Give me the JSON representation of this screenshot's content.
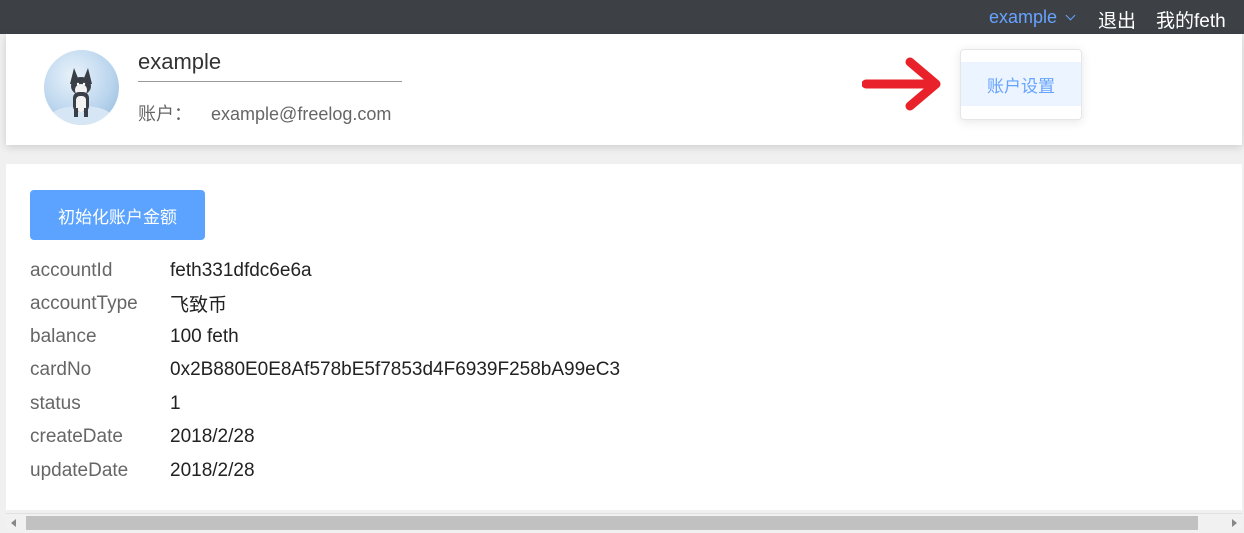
{
  "header": {
    "username": "example",
    "logout_label": "退出",
    "my_feth_label": "我的feth"
  },
  "dropdown": {
    "items": [
      {
        "label": "账户设置"
      }
    ]
  },
  "profile": {
    "name": "example",
    "account_label": "账户：",
    "account_value": "example@freelog.com"
  },
  "main": {
    "init_button_label": "初始化账户金额",
    "fields": [
      {
        "key": "accountId",
        "value": "feth331dfdc6e6a"
      },
      {
        "key": "accountType",
        "value": "飞致币"
      },
      {
        "key": "balance",
        "value": "100 feth"
      },
      {
        "key": "cardNo",
        "value": "0x2B880E0E8Af578bE5f7853d4F6939F258bA99eC3"
      },
      {
        "key": "status",
        "value": "1"
      },
      {
        "key": "createDate",
        "value": "2018/2/28"
      },
      {
        "key": "updateDate",
        "value": "2018/2/28"
      }
    ]
  },
  "colors": {
    "topbar": "#3d4145",
    "accent": "#66a3ff",
    "button": "#5ba3ff",
    "annotation_arrow": "#e8212a"
  }
}
